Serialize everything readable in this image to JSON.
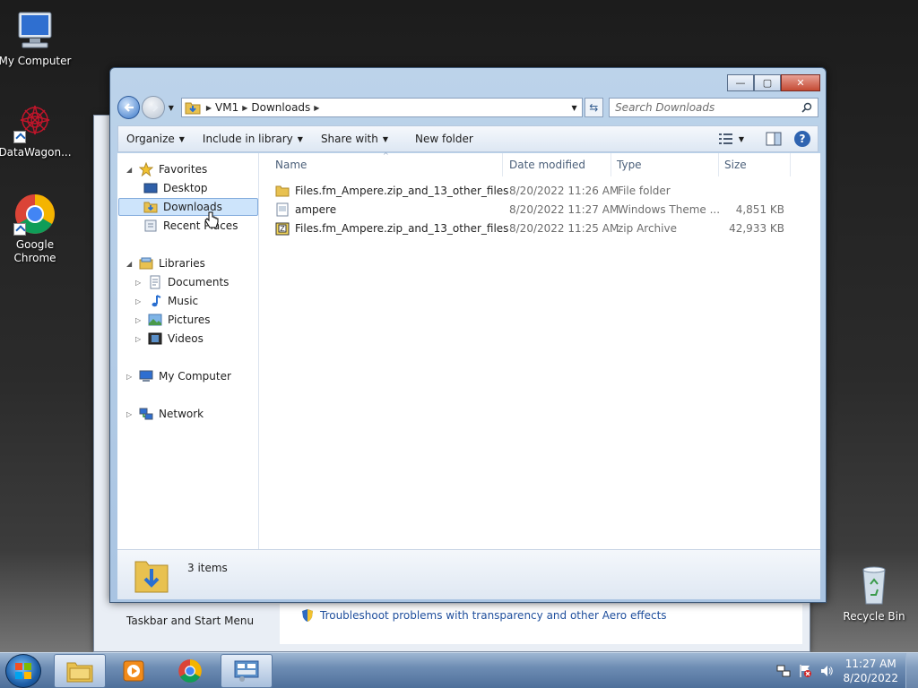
{
  "desktop": {
    "icons": [
      {
        "label": "My Computer",
        "icon": "computer-icon"
      },
      {
        "label": "DataWagon...",
        "icon": "datawagon-icon"
      },
      {
        "label": "Google\nChrome",
        "icon": "chrome-icon"
      },
      {
        "label": "Recycle Bin",
        "icon": "recycle-bin-icon"
      }
    ]
  },
  "bg_window": {
    "left_label": "Taskbar and Start Menu",
    "link": "Troubleshoot problems with transparency and other Aero effects"
  },
  "explorer": {
    "address": [
      "VM1",
      "Downloads"
    ],
    "search_placeholder": "Search Downloads",
    "toolbar": {
      "organize": "Organize",
      "include": "Include in library",
      "share": "Share with",
      "new_folder": "New folder"
    },
    "nav": {
      "favorites": "Favorites",
      "desktop": "Desktop",
      "downloads": "Downloads",
      "recent": "Recent Places",
      "libraries": "Libraries",
      "documents": "Documents",
      "music": "Music",
      "pictures": "Pictures",
      "videos": "Videos",
      "computer": "My Computer",
      "network": "Network"
    },
    "columns": {
      "name": "Name",
      "date": "Date modified",
      "type": "Type",
      "size": "Size"
    },
    "files": [
      {
        "name": "Files.fm_Ampere.zip_and_13_other_files",
        "date": "8/20/2022 11:26 AM",
        "type": "File folder",
        "size": "",
        "icon": "folder-icon"
      },
      {
        "name": "ampere",
        "date": "8/20/2022 11:27 AM",
        "type": "Windows Theme ...",
        "size": "4,851 KB",
        "icon": "theme-file-icon"
      },
      {
        "name": "Files.fm_Ampere.zip_and_13_other_files",
        "date": "8/20/2022 11:25 AM",
        "type": "zip Archive",
        "size": "42,933 KB",
        "icon": "zip-icon"
      }
    ],
    "status": "3 items"
  },
  "taskbar": {
    "time": "11:27 AM",
    "date": "8/20/2022"
  }
}
